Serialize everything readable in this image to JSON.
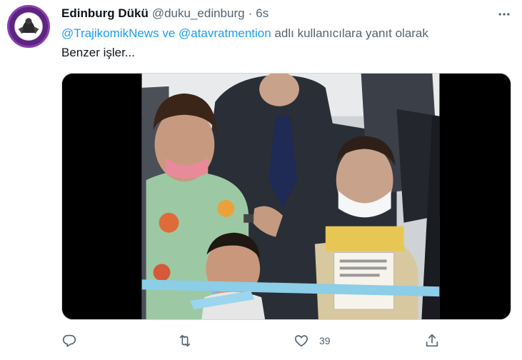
{
  "tweet": {
    "author": {
      "display_name": "Edinburg Dükü",
      "handle": "@duku_edinburg",
      "separator": "·",
      "time": "6s"
    },
    "reply_to": {
      "mention_1": "@TrajikomikNews",
      "connector": " ve ",
      "mention_2": "@atavratmention",
      "suffix": " adlı kullanıcılara yanıt olarak"
    },
    "text": "Benzer işler...",
    "media": {
      "type": "video"
    },
    "actions": {
      "reply_icon": "reply-icon",
      "retweet_icon": "retweet-icon",
      "like_icon": "heart-icon",
      "like_count": "39",
      "share_icon": "share-icon"
    }
  },
  "colors": {
    "accent": "#1d9bf0",
    "secondary_text": "#536471",
    "primary_text": "#0f1419"
  }
}
